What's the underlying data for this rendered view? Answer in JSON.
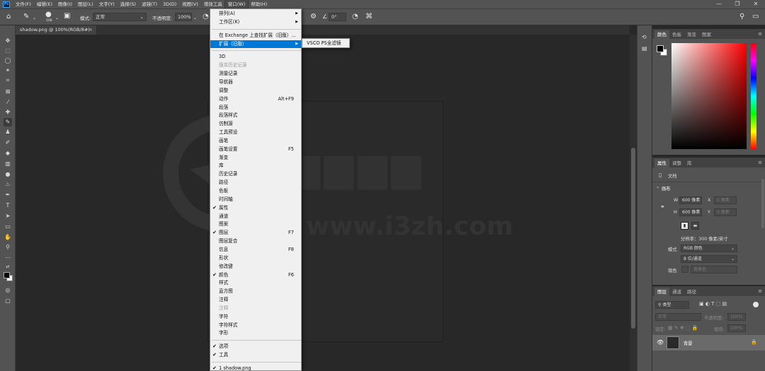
{
  "menubar": {
    "logo": "Ps",
    "items": [
      "文件(F)",
      "编辑(E)",
      "图像(I)",
      "图层(L)",
      "文字(Y)",
      "选择(S)",
      "滤镜(T)",
      "3D(D)",
      "视图(V)",
      "增效工具",
      "窗口(W)",
      "帮助(H)"
    ],
    "window_controls": [
      "—",
      "❐",
      "✕"
    ]
  },
  "options": {
    "brush_size": "106",
    "mode_label": "模式:",
    "mode_value": "正常",
    "opacity_label": "不透明度:",
    "opacity_value": "100%",
    "angle_value": "0°"
  },
  "document": {
    "tab_title": "shadow.png @ 100%(RGB/8#)",
    "tab_close": "×",
    "watermark_url": "www.i3zh.com"
  },
  "window_menu": {
    "items": [
      {
        "label": "排列(A)",
        "arrow": true
      },
      {
        "label": "工作区(K)",
        "arrow": true
      },
      {
        "sep": true
      },
      {
        "label": "在 Exchange 上查找扩展（旧版）..."
      },
      {
        "label": "扩展（旧版）",
        "arrow": true,
        "highlight": true
      },
      {
        "sep": true
      },
      {
        "label": "3D"
      },
      {
        "label": "版本历史记录",
        "disabled": true
      },
      {
        "label": "测量记录"
      },
      {
        "label": "导航器"
      },
      {
        "label": "调整"
      },
      {
        "label": "动作",
        "shortcut": "Alt+F9"
      },
      {
        "label": "段落"
      },
      {
        "label": "段落样式"
      },
      {
        "label": "仿制源"
      },
      {
        "label": "工具预设"
      },
      {
        "label": "画笔"
      },
      {
        "label": "画笔设置",
        "shortcut": "F5"
      },
      {
        "label": "渐变"
      },
      {
        "label": "库"
      },
      {
        "label": "历史记录"
      },
      {
        "label": "路径"
      },
      {
        "label": "色板"
      },
      {
        "label": "时间轴"
      },
      {
        "label": "属性",
        "checked": true
      },
      {
        "label": "通道"
      },
      {
        "label": "图案"
      },
      {
        "label": "图层",
        "checked": true,
        "shortcut": "F7"
      },
      {
        "label": "图层复合"
      },
      {
        "label": "信息",
        "shortcut": "F8"
      },
      {
        "label": "形状"
      },
      {
        "label": "修改键"
      },
      {
        "label": "颜色",
        "checked": true,
        "shortcut": "F6"
      },
      {
        "label": "样式"
      },
      {
        "label": "直方图"
      },
      {
        "label": "注释"
      },
      {
        "label": "注释",
        "disabled": true
      },
      {
        "label": "字符"
      },
      {
        "label": "字符样式"
      },
      {
        "label": "字形"
      },
      {
        "sep": true
      },
      {
        "label": "选项",
        "checked": true
      },
      {
        "label": "工具",
        "checked": true
      },
      {
        "sep": true
      },
      {
        "label": "1 shadow.png",
        "checked": true
      }
    ],
    "submenu_label": "VSCO PS全滤镜"
  },
  "color_panel": {
    "tabs": [
      "颜色",
      "色板",
      "渐变",
      "图案"
    ],
    "colors": {
      "hue_top": "#ff0000",
      "foreground": "#000000",
      "background": "#ffffff"
    }
  },
  "properties_panel": {
    "tabs": [
      "属性",
      "调整",
      "库"
    ],
    "doc_label": "文档",
    "section": "画布",
    "w_label": "W",
    "w_value": "600 像素",
    "x_label": "X",
    "x_placeholder": "0 像素",
    "h_label": "H",
    "h_value": "600 像素",
    "y_label": "Y",
    "y_placeholder": "0 像素",
    "resolution": "分辨率：300 像素/英寸",
    "mode_label": "模式",
    "mode_value": "RGB 颜色",
    "depth_value": "8 位/通道",
    "bg_label": "填色",
    "bg_value": "背景色"
  },
  "layers_panel": {
    "tabs": [
      "图层",
      "通道",
      "路径"
    ],
    "filter_kind": "类型",
    "blend": "正常",
    "opacity_label": "不透明度:",
    "opacity_value": "100%",
    "lock_label": "锁定:",
    "fill_label": "填充:",
    "fill_value": "100%",
    "layer_name": "背景"
  }
}
